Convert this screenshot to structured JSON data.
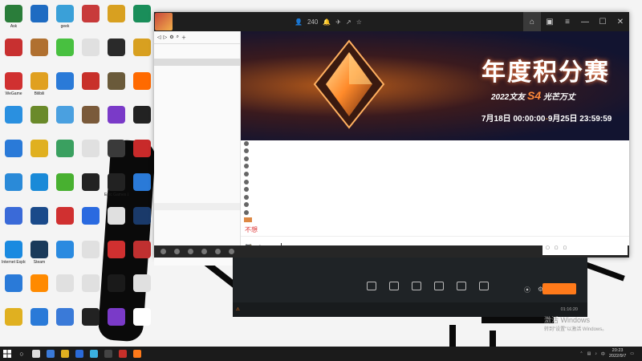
{
  "desktop": {
    "icons": [
      {
        "label": "Ask",
        "color": "#2a7d3a"
      },
      {
        "label": "",
        "color": "#1e6bc2"
      },
      {
        "label": "geek",
        "color": "#3aa0d8"
      },
      {
        "label": "",
        "color": "#c83a3a"
      },
      {
        "label": "",
        "color": "#d8a020"
      },
      {
        "label": "",
        "color": "#1a8e5a"
      },
      {
        "label": "",
        "color": "#c83030"
      },
      {
        "label": "",
        "color": "#b07030"
      },
      {
        "label": "",
        "color": "#48c040"
      },
      {
        "label": "",
        "color": "#e0e0e0"
      },
      {
        "label": "",
        "color": "#2a2a2a"
      },
      {
        "label": "",
        "color": "#d8a020"
      },
      {
        "label": "WeGame",
        "color": "#d03030"
      },
      {
        "label": "Bilibili",
        "color": "#e0a020"
      },
      {
        "label": "",
        "color": "#2a7ad8"
      },
      {
        "label": "",
        "color": "#c8302a"
      },
      {
        "label": "",
        "color": "#6a5a3a"
      },
      {
        "label": "",
        "color": "#ff6a00"
      },
      {
        "label": "",
        "color": "#2a90e0"
      },
      {
        "label": "",
        "color": "#6a8a2a"
      },
      {
        "label": "",
        "color": "#4aa0e0"
      },
      {
        "label": "",
        "color": "#7a5a3a"
      },
      {
        "label": "",
        "color": "#7a3ac8"
      },
      {
        "label": "",
        "color": "#222222"
      },
      {
        "label": "",
        "color": "#2a7ad8"
      },
      {
        "label": "",
        "color": "#e0b020"
      },
      {
        "label": "",
        "color": "#3aa060"
      },
      {
        "label": "",
        "color": "#e0e0e0"
      },
      {
        "label": "",
        "color": "#3a3a3a"
      },
      {
        "label": "",
        "color": "#c82a2a"
      },
      {
        "label": "",
        "color": "#2a8ad8"
      },
      {
        "label": "",
        "color": "#1a8ad8"
      },
      {
        "label": "",
        "color": "#48b030"
      },
      {
        "label": "",
        "color": "#222222"
      },
      {
        "label": "Epic Games Launcher",
        "color": "#222222"
      },
      {
        "label": "",
        "color": "#2a7ad8"
      },
      {
        "label": "",
        "color": "#3a6ad8"
      },
      {
        "label": "",
        "color": "#1a4a8a"
      },
      {
        "label": "",
        "color": "#d03030"
      },
      {
        "label": "",
        "color": "#2a6ae0"
      },
      {
        "label": "",
        "color": "#e0e0e0"
      },
      {
        "label": "",
        "color": "#1a3a6a"
      },
      {
        "label": "Internet Explorer",
        "color": "#1a8ae0"
      },
      {
        "label": "Steam",
        "color": "#1a3a5a"
      },
      {
        "label": "",
        "color": "#2a8ae0"
      },
      {
        "label": "",
        "color": "#e0e0e0"
      },
      {
        "label": "",
        "color": "#d03030"
      },
      {
        "label": "",
        "color": "#c03030"
      },
      {
        "label": "",
        "color": "#2a7ad8"
      },
      {
        "label": "",
        "color": "#ff8a00"
      },
      {
        "label": "",
        "color": "#e0e0e0"
      },
      {
        "label": "",
        "color": "#e0e0e0"
      },
      {
        "label": "",
        "color": "#1a1a1a"
      },
      {
        "label": "",
        "color": "#e0e0e0"
      },
      {
        "label": "",
        "color": "#e0b020"
      },
      {
        "label": "",
        "color": "#2a7ad8"
      },
      {
        "label": "",
        "color": "#3a7ad8"
      },
      {
        "label": "",
        "color": "#222222"
      },
      {
        "label": "",
        "color": "#7a3ac8"
      },
      {
        "label": "",
        "color": "#ffffff"
      }
    ]
  },
  "chat_window": {
    "title": "",
    "member_count": "240",
    "sidebar": {
      "items": [
        {
          "label": "",
          "cls": ""
        },
        {
          "label": "",
          "cls": "red"
        },
        {
          "label": "",
          "cls": "sel"
        },
        {
          "label": "",
          "cls": ""
        },
        {
          "label": "",
          "cls": ""
        },
        {
          "label": "",
          "cls": ""
        }
      ],
      "channels": [
        "",
        "",
        "",
        "",
        "",
        "",
        "",
        "",
        "",
        "",
        "",
        "",
        "",
        "",
        "",
        ""
      ],
      "group_label": "",
      "members": [
        "",
        "",
        "",
        "",
        "",
        "",
        "",
        "",
        "",
        ""
      ]
    },
    "banner": {
      "title": "年度积分赛",
      "subtitle_a": "2022文友",
      "subtitle_b": "S4",
      "subtitle_c": "光芒万丈",
      "date_start": "7月18日 00:00:00",
      "date_sep": "-",
      "date_end": "9月25日 23:59:59"
    },
    "messages": [
      "",
      "",
      "",
      "",
      "",
      "",
      "",
      "",
      "",
      ""
    ],
    "pink_message": "",
    "typed_text": "不想",
    "input_right_labels": [
      "",
      "",
      ""
    ]
  },
  "voice_bar": {
    "items": [
      "",
      "",
      "",
      "",
      "",
      ""
    ],
    "right_label": ""
  },
  "live_panel": {
    "left_buttons": [
      {
        "glyph": "",
        "label": ""
      },
      {
        "glyph": "",
        "label": ""
      },
      {
        "glyph": "",
        "label": ""
      }
    ],
    "tools": [
      "",
      "",
      "",
      "",
      "",
      ""
    ],
    "live_button": "",
    "status_text": "",
    "stats": [
      "",
      "",
      ""
    ],
    "time": "01:16:20"
  },
  "watermark": {
    "line1": "激活 Windows",
    "line2": "转到\"设置\"以激活 Windows。"
  },
  "taskbar": {
    "apps": [
      "#dddddd",
      "#3a7ad8",
      "#e0b020",
      "#2a6ad8",
      "#3ab0e0",
      "#444444",
      "#c8302a",
      "#ff7a1a"
    ],
    "clock_time": "20:23",
    "clock_date": "2022/9/7"
  }
}
